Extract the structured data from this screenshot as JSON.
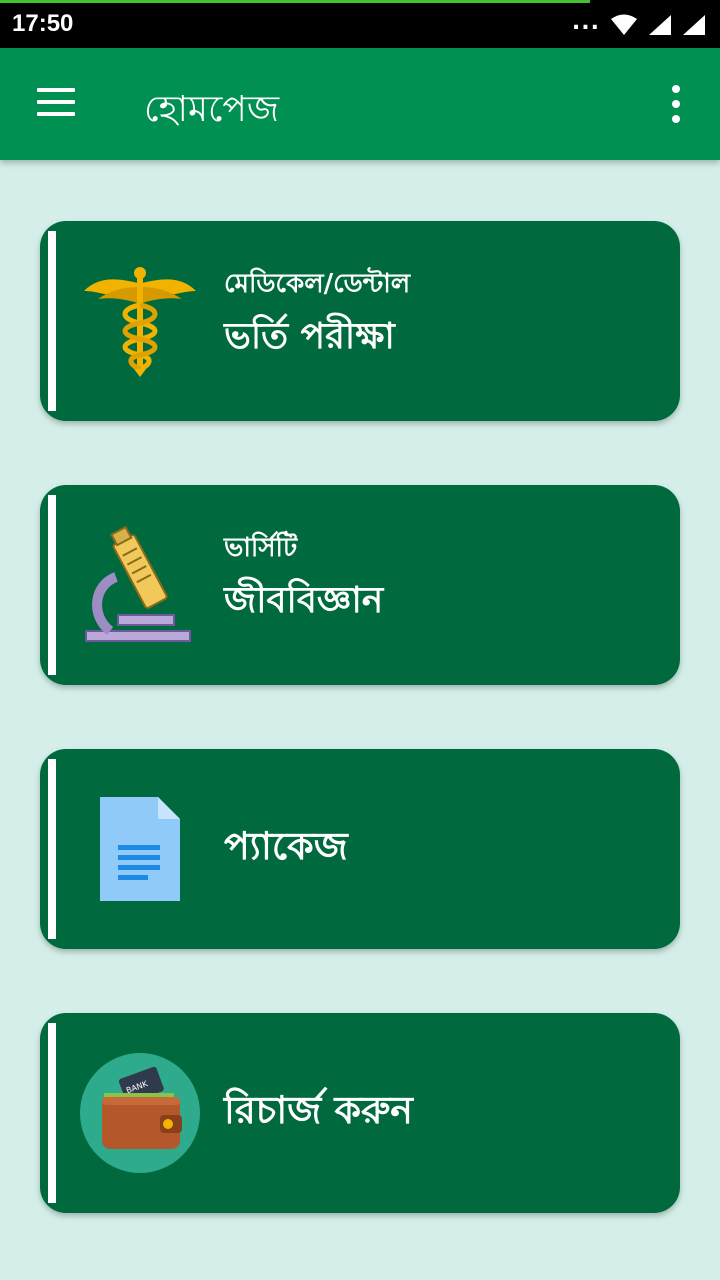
{
  "status_bar": {
    "time": "17:50",
    "dots": "...",
    "icons": [
      "wifi-icon",
      "signal-icon",
      "signal-icon"
    ]
  },
  "app_bar": {
    "title": "হোমপেজ",
    "menu_icon": "hamburger-menu-icon",
    "overflow_icon": "more-vert-icon"
  },
  "colors": {
    "app_bar": "#009051",
    "card": "#006a3e",
    "background": "#d4efe9",
    "progress": "#43c22f"
  },
  "cards": [
    {
      "icon": "caduceus-icon",
      "subtitle": "মেডিকেল/ডেন্টাল",
      "title": "ভর্তি পরীক্ষা"
    },
    {
      "icon": "microscope-icon",
      "subtitle": "ভার্সিটি",
      "title": "জীববিজ্ঞান"
    },
    {
      "icon": "document-icon",
      "subtitle": "",
      "title": "প্যাকেজ"
    },
    {
      "icon": "wallet-icon",
      "subtitle": "",
      "title": "রিচার্জ করুন"
    }
  ]
}
